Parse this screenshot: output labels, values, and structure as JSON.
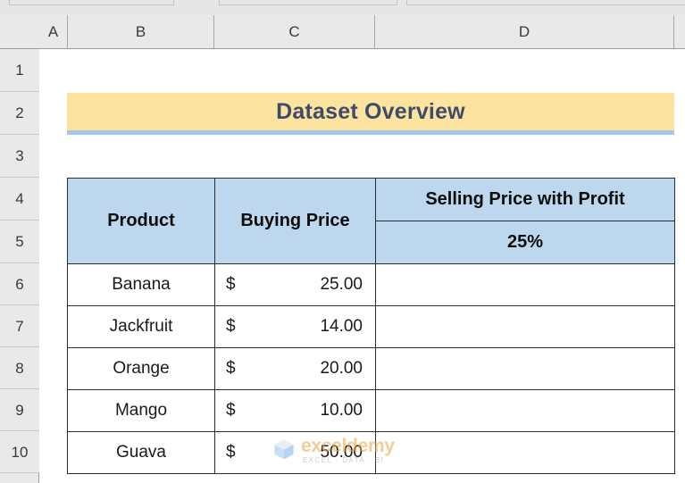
{
  "app": {
    "type": "spreadsheet",
    "column_headers": [
      "A",
      "B",
      "C",
      "D"
    ],
    "row_headers": [
      "1",
      "2",
      "3",
      "4",
      "5",
      "6",
      "7",
      "8",
      "9",
      "10"
    ]
  },
  "title_banner": {
    "text": "Dataset Overview",
    "fill_color": "#FCE4A0",
    "text_color": "#3E4B69",
    "underline_color": "#A7C6E8"
  },
  "table": {
    "header_fill": "#BDD7EE",
    "border_color": "#2B2B2B",
    "headers": {
      "product": "Product",
      "buying_price": "Buying Price",
      "selling_price_line1": "Selling Price with Profit",
      "selling_price_line2": "25%"
    },
    "rows": [
      {
        "product": "Banana",
        "currency": "$",
        "buying_price": "25.00",
        "selling_price": ""
      },
      {
        "product": "Jackfruit",
        "currency": "$",
        "buying_price": "14.00",
        "selling_price": ""
      },
      {
        "product": "Orange",
        "currency": "$",
        "buying_price": "20.00",
        "selling_price": ""
      },
      {
        "product": "Mango",
        "currency": "$",
        "buying_price": "10.00",
        "selling_price": ""
      },
      {
        "product": "Guava",
        "currency": "$",
        "buying_price": "50.00",
        "selling_price": ""
      }
    ]
  },
  "watermark": {
    "brand": "exceldemy",
    "tagline": "EXCEL · DATA · BI",
    "brand_color": "#E8A33D"
  }
}
